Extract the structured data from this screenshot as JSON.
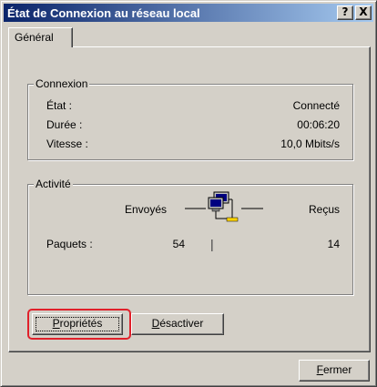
{
  "window": {
    "title": "État de Connexion au réseau local",
    "help_label": "?",
    "close_label": "X"
  },
  "tabs": [
    {
      "label": "Général"
    }
  ],
  "connexion": {
    "legend": "Connexion",
    "rows": [
      {
        "label": "État :",
        "value": "Connecté"
      },
      {
        "label": "Durée :",
        "value": "00:06:20"
      },
      {
        "label": "Vitesse :",
        "value": "10,0 Mbits/s"
      }
    ]
  },
  "activite": {
    "legend": "Activité",
    "sent_label": "Envoyés",
    "received_label": "Reçus",
    "packets_label": "Paquets :",
    "packets_sent": "54",
    "packets_received": "14",
    "separator": "|"
  },
  "buttons": {
    "properties_prefix": "",
    "properties_accel": "P",
    "properties_rest": "ropriétés",
    "disable_accel": "D",
    "disable_rest": "ésactiver",
    "close_accel": "F",
    "close_rest": "ermer"
  },
  "colors": {
    "titlebar_start": "#0a246a",
    "titlebar_end": "#a6caf0",
    "highlight": "#e0202a"
  }
}
